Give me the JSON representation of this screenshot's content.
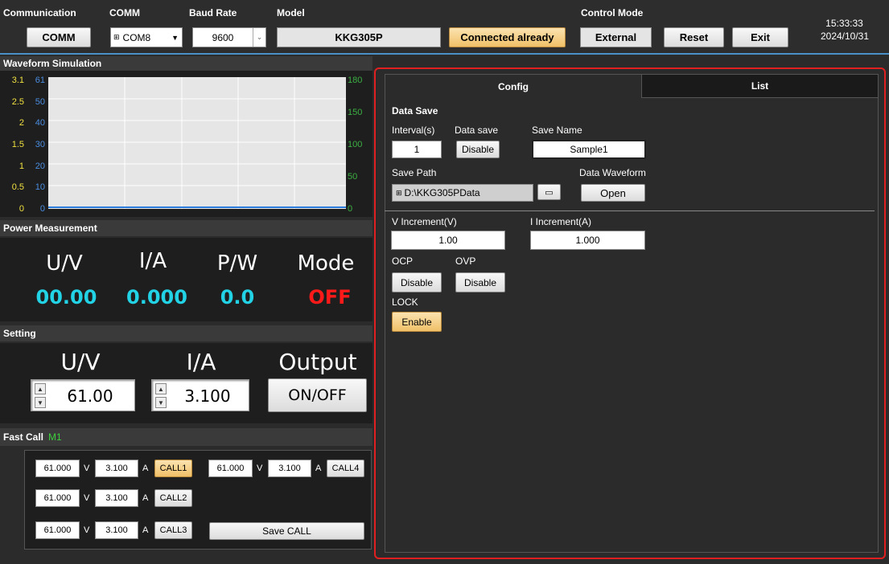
{
  "header": {
    "communication_label": "Communication",
    "comm_label": "COMM",
    "baud_label": "Baud Rate",
    "model_label": "Model",
    "control_mode_label": "Control Mode",
    "comm_button": "COMM",
    "comm_port": "COM8",
    "baud_rate": "9600",
    "model": "KKG305P",
    "status": "Connected already",
    "control_mode": "External",
    "reset": "Reset",
    "exit": "Exit",
    "time": "15:33:33",
    "date": "2024/10/31"
  },
  "waveform": {
    "title": "Waveform Simulation",
    "left_axis_a": [
      "3.1",
      "2.5",
      "2",
      "1.5",
      "1",
      "0.5",
      "0"
    ],
    "left_axis_b": [
      "61",
      "50",
      "40",
      "30",
      "20",
      "10",
      "0"
    ],
    "right_axis": [
      "180",
      "150",
      "100",
      "50",
      "0"
    ],
    "colors": {
      "axis_a": "#f0e040",
      "axis_b": "#4a8de0",
      "axis_right": "#3cb043"
    }
  },
  "power": {
    "title": "Power  Measurement",
    "u_label": "U/V",
    "i_label": "I/A",
    "p_label": "P/W",
    "mode_label": "Mode",
    "u_value": "00.00",
    "i_value": "0.000",
    "p_value": "0.0",
    "mode_value": "OFF",
    "colors": {
      "value": "#22d3e6",
      "mode": "#ff1a1a"
    }
  },
  "setting": {
    "title": "Setting",
    "u_label": "U/V",
    "i_label": "I/A",
    "output_label": "Output",
    "u_value": "61.00",
    "i_value": "3.100",
    "output_button": "ON/OFF"
  },
  "fast_call": {
    "title": "Fast Call",
    "memory": "M1",
    "rows": [
      {
        "v": "61.000",
        "a": "3.100",
        "call": "CALL1"
      },
      {
        "v": "61.000",
        "a": "3.100",
        "call": "CALL2"
      },
      {
        "v": "61.000",
        "a": "3.100",
        "call": "CALL3"
      },
      {
        "v": "61.000",
        "a": "3.100",
        "call": "CALL4"
      }
    ],
    "v_unit": "V",
    "a_unit": "A",
    "save_call": "Save CALL"
  },
  "config": {
    "tab_config": "Config",
    "tab_list": "List",
    "data_save_title": "Data Save",
    "interval_label": "Interval(s)",
    "interval_value": "1",
    "data_save_label": "Data save",
    "data_save_button": "Disable",
    "save_name_label": "Save Name",
    "save_name_value": "Sample1",
    "save_path_label": "Save Path",
    "save_path_value": "D:\\KKG305PData",
    "data_waveform_label": "Data Waveform",
    "open_button": "Open",
    "v_increment_label": "V Increment(V)",
    "v_increment_value": "1.00",
    "i_increment_label": "I Increment(A)",
    "i_increment_value": "1.000",
    "ocp_label": "OCP",
    "ocp_button": "Disable",
    "ovp_label": "OVP",
    "ovp_button": "Disable",
    "lock_label": "LOCK",
    "lock_button": "Enable",
    "highlight_color": "#e02020"
  }
}
